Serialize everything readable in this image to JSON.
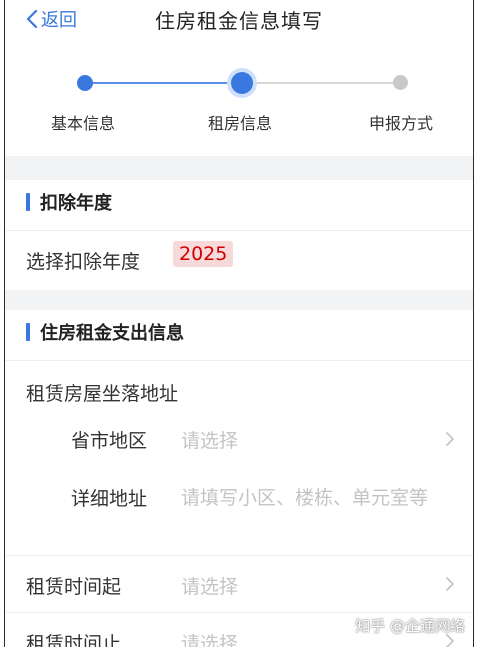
{
  "nav": {
    "back_label": "返回",
    "title": "住房租金信息填写"
  },
  "stepper": {
    "steps": [
      {
        "label": "基本信息",
        "state": "done"
      },
      {
        "label": "租房信息",
        "state": "current"
      },
      {
        "label": "申报方式",
        "state": "todo"
      }
    ]
  },
  "deduction_section": {
    "title": "扣除年度",
    "year_label": "选择扣除年度",
    "year_value": "2025"
  },
  "rent_section": {
    "title": "住房租金支出信息",
    "address_label": "租赁房屋坐落地址",
    "province": {
      "label": "省市地区",
      "placeholder": "请选择"
    },
    "detail": {
      "label": "详细地址",
      "placeholder": "请填写小区、楼栋、单元室等"
    },
    "start": {
      "label": "租赁时间起",
      "placeholder": "请选择"
    },
    "end": {
      "label": "租赁时间止",
      "placeholder": "请选择"
    }
  },
  "watermark": "知乎 @企通网络",
  "colors": {
    "accent": "#3a78e0",
    "year_highlight": "#d00000",
    "placeholder": "#c4c4c4",
    "divider_bg": "#f2f3f5"
  }
}
